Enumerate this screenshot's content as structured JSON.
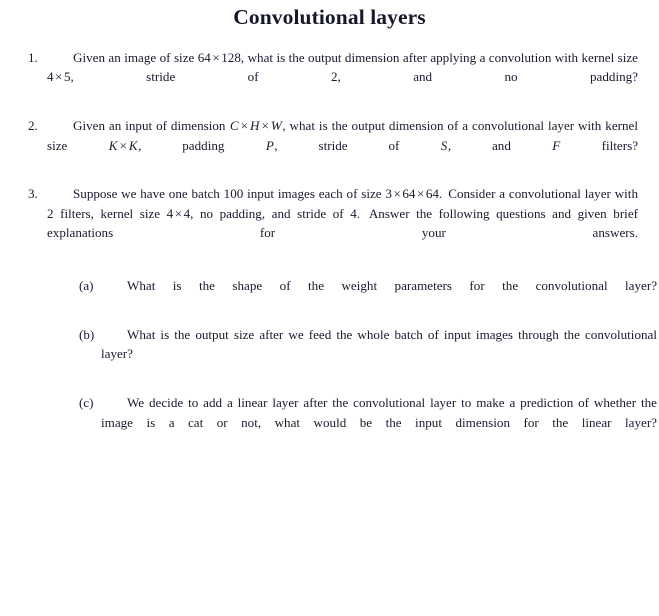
{
  "document": {
    "title": "Convolutional layers",
    "background_color": "#ffffff",
    "text_color": "#1a1a2e"
  },
  "questions": [
    {
      "number": "1.",
      "segments": [
        {
          "type": "text",
          "value": "Given an image of size "
        },
        {
          "type": "math",
          "value": "64"
        },
        {
          "type": "times",
          "value": "×"
        },
        {
          "type": "math",
          "value": "128"
        },
        {
          "type": "text",
          "value": ", what is the output dimension after applying a convolution with kernel size "
        },
        {
          "type": "math",
          "value": "4"
        },
        {
          "type": "times",
          "value": "×"
        },
        {
          "type": "math",
          "value": "5"
        },
        {
          "type": "text",
          "value": ", stride of "
        },
        {
          "type": "math",
          "value": "2"
        },
        {
          "type": "text",
          "value": ", and no padding?"
        }
      ],
      "plain": "Given an image of size 64 × 128, what is the output dimension after applying a convolution with kernel size 4 × 5, stride of 2, and no padding?"
    },
    {
      "number": "2.",
      "segments": [
        {
          "type": "text",
          "value": "Given an input of dimension "
        },
        {
          "type": "var",
          "value": "C"
        },
        {
          "type": "times",
          "value": "×"
        },
        {
          "type": "var",
          "value": "H"
        },
        {
          "type": "times",
          "value": "×"
        },
        {
          "type": "var",
          "value": "W"
        },
        {
          "type": "text",
          "value": ", what is the output dimension of a convolutional layer with kernel size "
        },
        {
          "type": "var",
          "value": "K"
        },
        {
          "type": "times",
          "value": "×"
        },
        {
          "type": "var",
          "value": "K"
        },
        {
          "type": "text",
          "value": ", padding "
        },
        {
          "type": "var",
          "value": "P"
        },
        {
          "type": "text",
          "value": ", stride of "
        },
        {
          "type": "var",
          "value": "S"
        },
        {
          "type": "text",
          "value": ", and "
        },
        {
          "type": "var",
          "value": "F"
        },
        {
          "type": "text",
          "value": " filters?"
        }
      ],
      "plain": "Given an input of dimension C × H × W, what is the output dimension of a convolutional layer with kernel size K × K, padding P, stride of S, and F filters?"
    },
    {
      "number": "3.",
      "segments": [
        {
          "type": "text",
          "value": "Suppose we have one batch 100 input images each of size "
        },
        {
          "type": "math",
          "value": "3"
        },
        {
          "type": "times",
          "value": "×"
        },
        {
          "type": "math",
          "value": "64"
        },
        {
          "type": "times",
          "value": "×"
        },
        {
          "type": "math",
          "value": "64"
        },
        {
          "type": "text",
          "value": "."
        },
        {
          "type": "sentencespace",
          "value": " "
        },
        {
          "type": "text",
          "value": "Consider a convolutional layer with 2 filters, kernel size "
        },
        {
          "type": "math",
          "value": "4"
        },
        {
          "type": "times",
          "value": "×"
        },
        {
          "type": "math",
          "value": "4"
        },
        {
          "type": "text",
          "value": ", no padding, and stride of "
        },
        {
          "type": "math",
          "value": "4"
        },
        {
          "type": "text",
          "value": "."
        },
        {
          "type": "sentencespace",
          "value": " "
        },
        {
          "type": "text",
          "value": "Answer the following questions and given brief explanations for your answers."
        }
      ],
      "plain": "Suppose we have one batch 100 input images each of size 3 × 64 × 64. Consider a convolutional layer with 2 filters, kernel size 4 × 4, no padding, and stride of 4. Answer the following questions and given brief explanations for your answers.",
      "subquestions": [
        {
          "label": "(a)",
          "text": "What is the shape of the weight parameters for the convolutional layer?"
        },
        {
          "label": "(b)",
          "text": "What is the output size after we feed the whole batch of input images through the convolutional layer?"
        },
        {
          "label": "(c)",
          "text": "We decide to add a linear layer after the convolutional layer to make a prediction of whether the image is a cat or not, what would be the input dimension for the linear layer?"
        }
      ]
    }
  ]
}
